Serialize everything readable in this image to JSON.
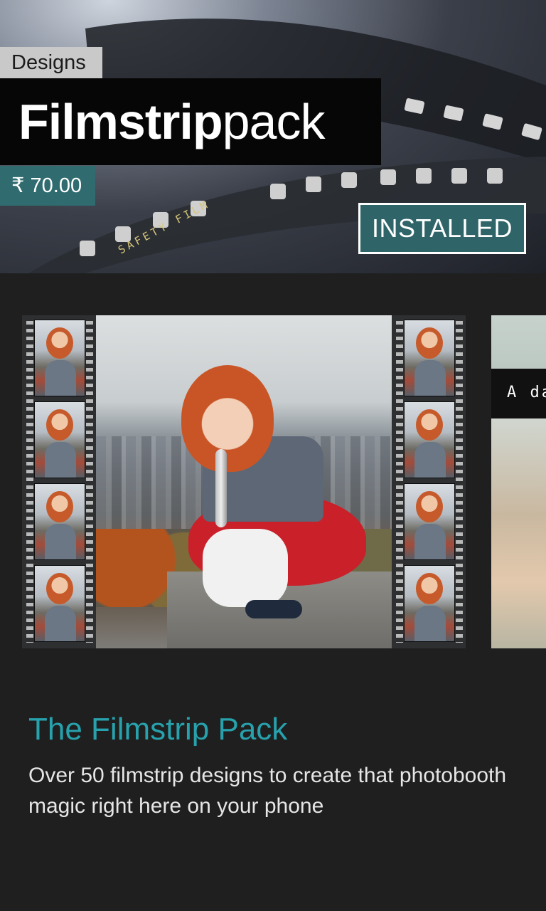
{
  "header": {
    "category": "Designs",
    "title_bold": "Filmstrip",
    "title_light": "pack",
    "price": "₹ 70.00",
    "install_status": "INSTALLED",
    "film_edge_text": "SAFETY FILM",
    "accent_color": "#2f6b6f"
  },
  "carousel": {
    "peek_caption": "A da"
  },
  "description": {
    "title": "The Filmstrip Pack",
    "body": "Over 50 filmstrip designs to create that photobooth magic right here on your phone",
    "title_color": "#27a2ad"
  }
}
